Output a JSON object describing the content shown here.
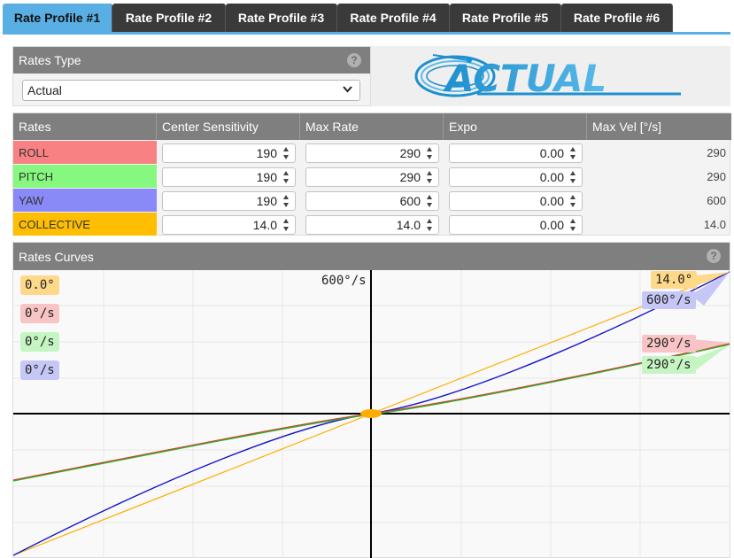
{
  "tabs": [
    {
      "label": "Rate Profile #1",
      "active": true
    },
    {
      "label": "Rate Profile #2",
      "active": false
    },
    {
      "label": "Rate Profile #3",
      "active": false
    },
    {
      "label": "Rate Profile #4",
      "active": false
    },
    {
      "label": "Rate Profile #5",
      "active": false
    },
    {
      "label": "Rate Profile #6",
      "active": false
    }
  ],
  "rates_type": {
    "title": "Rates Type",
    "help_icon": "help-icon",
    "selected": "Actual",
    "dropdown_icon": "chevron-down-icon"
  },
  "logo": {
    "text": "ACTUAL",
    "colors": [
      "#1e8fcf",
      "#5bb9e8"
    ]
  },
  "rates_table": {
    "headers": [
      "Rates",
      "Center Sensitivity",
      "Max Rate",
      "Expo",
      "Max Vel [°/s]"
    ],
    "rows": [
      {
        "axis": "ROLL",
        "color": "#f88184",
        "center": "190",
        "max_rate": "290",
        "expo": "0.00",
        "max_vel": "290"
      },
      {
        "axis": "PITCH",
        "color": "#86f77f",
        "center": "190",
        "max_rate": "290",
        "expo": "0.00",
        "max_vel": "290"
      },
      {
        "axis": "YAW",
        "color": "#8989f7",
        "center": "190",
        "max_rate": "600",
        "expo": "0.00",
        "max_vel": "600"
      },
      {
        "axis": "COLLECTIVE",
        "color": "#ffbe00",
        "center": "14.0",
        "max_rate": "14.0",
        "expo": "0.00",
        "max_vel": "14.0"
      }
    ]
  },
  "curves": {
    "title": "Rates Curves",
    "help_icon": "help-icon",
    "y_max_label": "600°/s",
    "legend": [
      {
        "text": "0.0°",
        "color": "#ffd98a"
      },
      {
        "text": "0°/s",
        "color": "#f8c4c5"
      },
      {
        "text": "0°/s",
        "color": "#c5f5c2"
      },
      {
        "text": "0°/s",
        "color": "#c7c7f7"
      }
    ],
    "end_labels": [
      {
        "text": "14.0°",
        "color": "#ffd98a"
      },
      {
        "text": "600°/s",
        "color": "#c7c7f7"
      },
      {
        "text": "290°/s",
        "color": "#f8c4c5"
      },
      {
        "text": "290°/s",
        "color": "#c5f5c2"
      }
    ],
    "series_colors": {
      "roll": "#e8322f",
      "pitch": "#26b326",
      "yaw": "#1414c8",
      "collective": "#ffae00"
    }
  }
}
